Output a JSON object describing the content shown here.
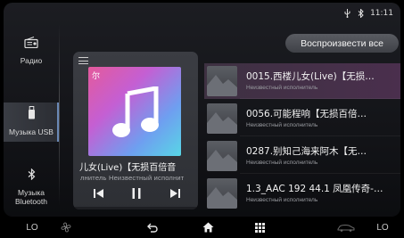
{
  "status_bar": {
    "time": "11:11",
    "icons": [
      "usb-icon",
      "bluetooth-icon"
    ]
  },
  "sidebar": {
    "items": [
      {
        "label": "Радио",
        "icon": "radio-icon",
        "active": false
      },
      {
        "label": "Музыка USB",
        "icon": "usb-drive-icon",
        "active": true
      },
      {
        "label": "Музыка Bluetooth",
        "icon": "bluetooth-icon",
        "active": false
      }
    ]
  },
  "play_all_label": "Воспроизвести все",
  "now_playing": {
    "cover_badge": "尔",
    "title": "儿女(Live)【无损百倍音",
    "artist": "лнитель    Неизвестный исполнит",
    "menu_icon": "menu-icon",
    "controls": [
      "prev-icon",
      "pause-icon",
      "next-icon"
    ],
    "progress_percent": 0
  },
  "songs": [
    {
      "title": "0015.西楼儿女(Live)【无损…",
      "artist": "Неизвестный исполнитель",
      "active": true
    },
    {
      "title": "0056.可能程响【无损百倍…",
      "artist": "Неизвестный исполнитель",
      "active": false
    },
    {
      "title": "0287.别知己海来阿木【无…",
      "artist": "Неизвестный исполнитель",
      "active": false
    },
    {
      "title": "1.3_AAC 192 44.1 凤凰传奇-…",
      "artist": "Неизвестный исполнитель",
      "active": false
    }
  ],
  "bottom_bar": {
    "left_label": "LO",
    "right_label": "LO",
    "icons": [
      "fan-icon",
      "back-icon",
      "home-icon",
      "apps-grid-icon",
      "car-icon"
    ]
  },
  "colors": {
    "accent": "#8fa8cf",
    "active_row": "#4a2f4d",
    "card_bg": "#35373c"
  }
}
